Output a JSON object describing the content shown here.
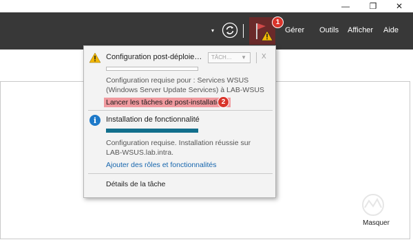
{
  "window": {
    "minimize_glyph": "—",
    "maximize_glyph": "❐",
    "close_glyph": "✕"
  },
  "toolbar": {
    "refresh_dropdown_glyph": "▾",
    "refresh_icon": "refresh-icon",
    "flag_icon": "flag-warning-icon",
    "notification_badge": "1",
    "menu": {
      "manage": "Gérer",
      "tools": "Outils",
      "view": "Afficher",
      "help": "Aide"
    },
    "colors": {
      "background": "#383838",
      "flag_bg": "#6a2a2a"
    }
  },
  "notifications": {
    "post_deploy": {
      "icon": "warning-icon",
      "title": "Configuration post-déploie…",
      "task_dropdown": "TÂCH…",
      "task_dropdown_arrow": "▼",
      "close_glyph": "X",
      "description": "Configuration requise pour : Services WSUS (Windows Server Update Services) à LAB-WSUS",
      "action_link": "Lancer les tâches de post-installation",
      "action_badge": "2"
    },
    "feature_install": {
      "icon": "info-icon",
      "icon_glyph": "i",
      "title": "Installation de fonctionnalité",
      "progress": 1.0,
      "description": "Configuration requise. Installation réussie sur LAB-WSUS.lab.intra.",
      "action_link": "Ajouter des rôles et fonctionnalités"
    },
    "task_details": "Détails de la tâche"
  },
  "pane": {
    "hide_label": "Masquer"
  },
  "colors": {
    "highlight": "#f09a9f",
    "link": "#1565ad",
    "progress_fill": "#126f8c",
    "badge": "#d9342b",
    "info": "#1d79c9",
    "warning": "#f2b705"
  }
}
